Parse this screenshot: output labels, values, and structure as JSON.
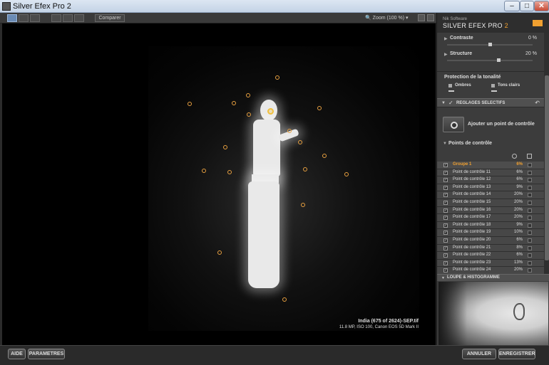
{
  "window": {
    "title": "Silver Efex Pro 2",
    "minimize": "–",
    "maximize": "□",
    "close": "✕"
  },
  "toolbar": {
    "compare_label": "Comparer",
    "zoom_label": "Zoom (100 %)"
  },
  "preview": {
    "image_name": "India (675 of 2624)-SEP.tif",
    "image_meta": "11.8 MP, ISO 100, Canon EOS 5D Mark II"
  },
  "panel": {
    "brand_vendor": "Nik Software",
    "brand_product": "SILVER EFEX PRO",
    "brand_version": "2",
    "contraste_label": "Contraste",
    "contraste_value": "0 %",
    "contraste_level": 0.5,
    "structure_label": "Structure",
    "structure_value": "20 %",
    "structure_level": 0.6,
    "tonal_header": "Protection de la tonalité",
    "ombres_label": "Ombres",
    "tons_clairs_label": "Tons clairs",
    "selective_header": "REGLAGES SELECTIFS",
    "add_cp_label": "Ajouter un point de contrôle",
    "cp_header": "Points de contrôle",
    "loupe_header": "LOUPE & HISTOGRAMME"
  },
  "control_points": [
    {
      "name": "Groupe 1",
      "pct": "6%",
      "group": true
    },
    {
      "name": "Point de contrôle 11",
      "pct": "6%"
    },
    {
      "name": "Point de contrôle 12",
      "pct": "6%"
    },
    {
      "name": "Point de contrôle 13",
      "pct": "9%"
    },
    {
      "name": "Point de contrôle 14",
      "pct": "20%"
    },
    {
      "name": "Point de contrôle 15",
      "pct": "20%"
    },
    {
      "name": "Point de contrôle 16",
      "pct": "20%"
    },
    {
      "name": "Point de contrôle 17",
      "pct": "20%"
    },
    {
      "name": "Point de contrôle 18",
      "pct": "9%"
    },
    {
      "name": "Point de contrôle 19",
      "pct": "10%"
    },
    {
      "name": "Point de contrôle 20",
      "pct": "6%"
    },
    {
      "name": "Point de contrôle 21",
      "pct": "8%"
    },
    {
      "name": "Point de contrôle 22",
      "pct": "6%"
    },
    {
      "name": "Point de contrôle 23",
      "pct": "13%"
    },
    {
      "name": "Point de contrôle 24",
      "pct": "20%"
    }
  ],
  "bottom": {
    "aide": "AIDE",
    "parametres": "PARAMETRES",
    "annuler": "ANNULER",
    "enregistrer": "ENREGISTRER"
  },
  "colors": {
    "accent": "#f0a030",
    "panel_bg": "#3c3c3c",
    "preview_bg": "#000000"
  }
}
